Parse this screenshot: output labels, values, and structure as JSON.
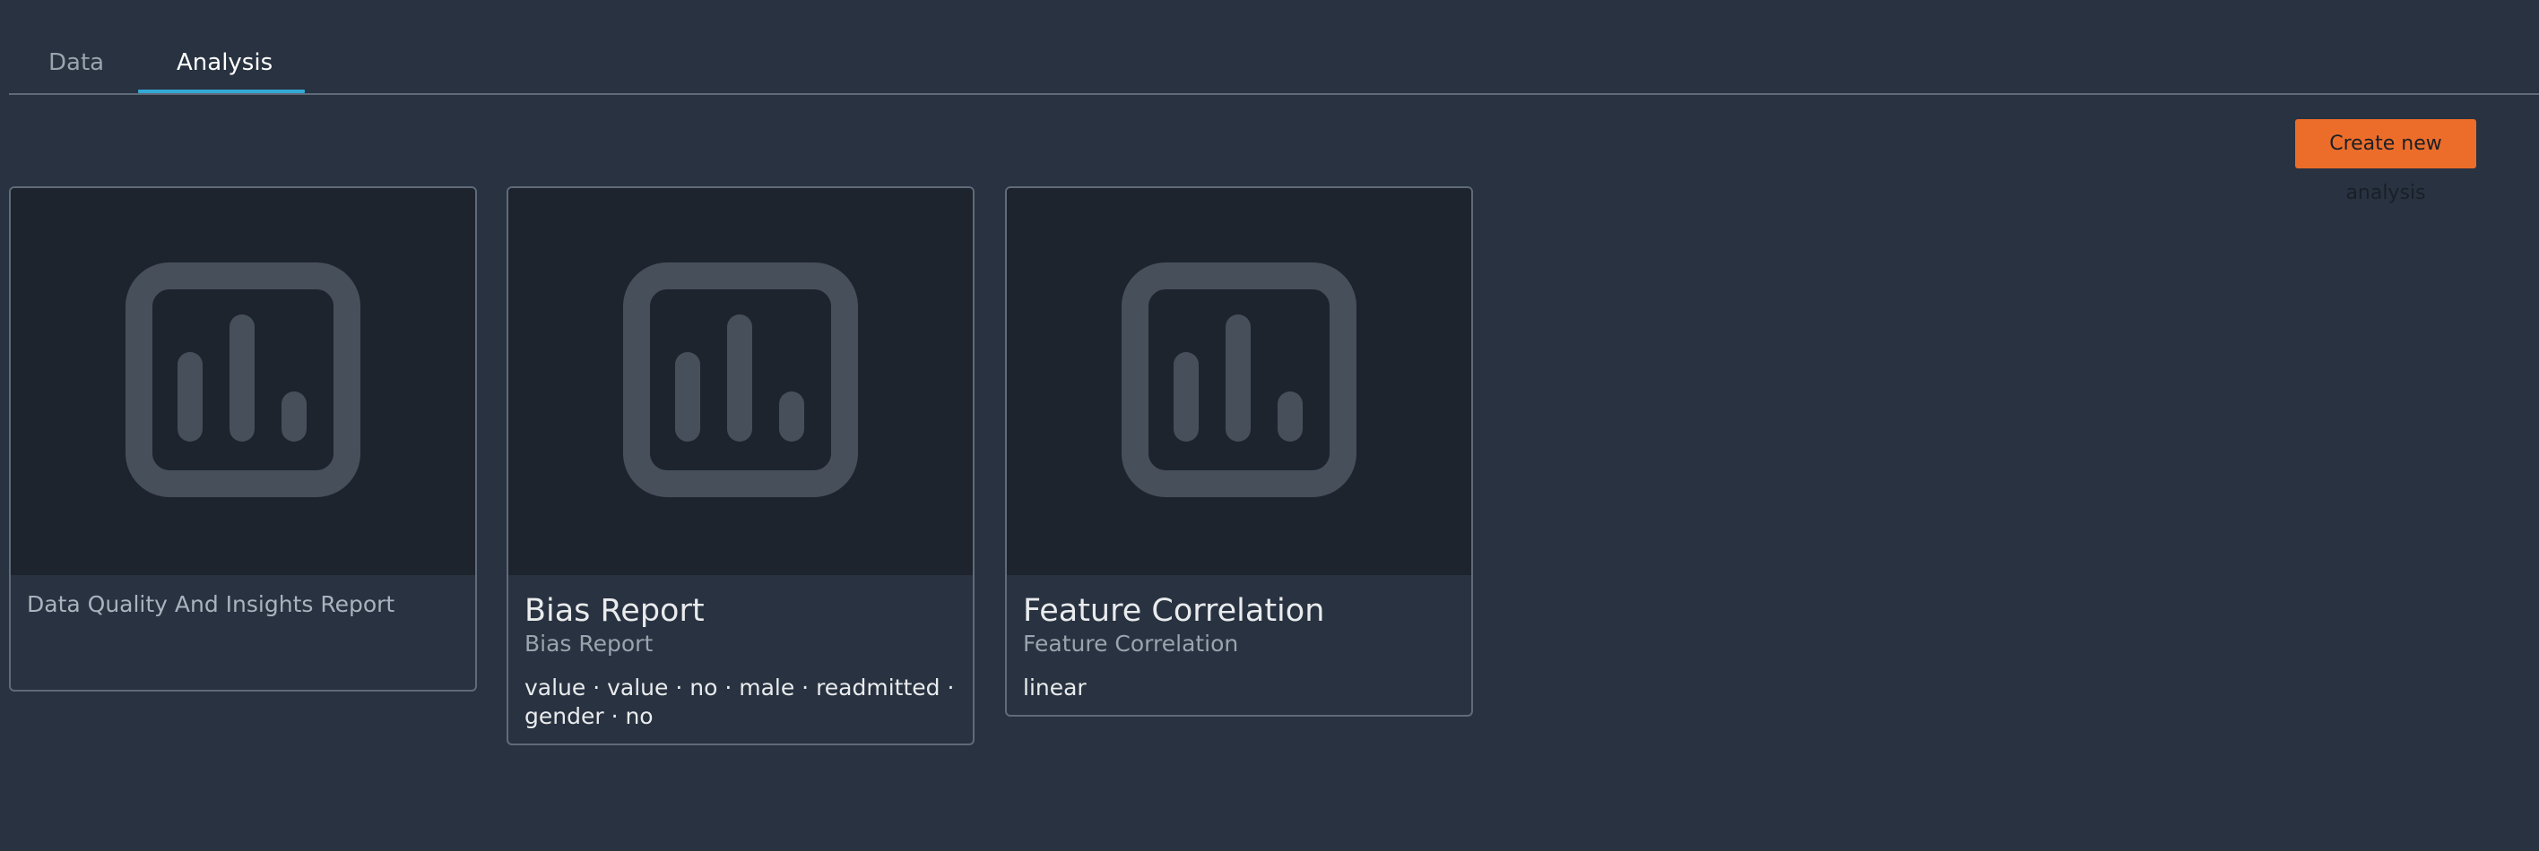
{
  "tabs": [
    {
      "label": "Data",
      "active": false
    },
    {
      "label": "Analysis",
      "active": true
    }
  ],
  "actions": {
    "create_label": "Create new analysis",
    "create_color": "#ec6d2a"
  },
  "cards": [
    {
      "icon": "bar-chart-icon",
      "title": "",
      "subtitle": "Data Quality And Insights Report",
      "meta": ""
    },
    {
      "icon": "bar-chart-icon",
      "title": "Bias Report",
      "subtitle": "Bias Report",
      "meta": "value · value · no · male · readmitted ·\ngender · no"
    },
    {
      "icon": "bar-chart-icon",
      "title": "Feature Correlation",
      "subtitle": "Feature Correlation",
      "meta": "linear"
    }
  ],
  "colors": {
    "background": "#283240",
    "thumbnail_background": "#1e242e",
    "icon": "#474f5b",
    "active_tab_indicator": "#33a9d6"
  }
}
